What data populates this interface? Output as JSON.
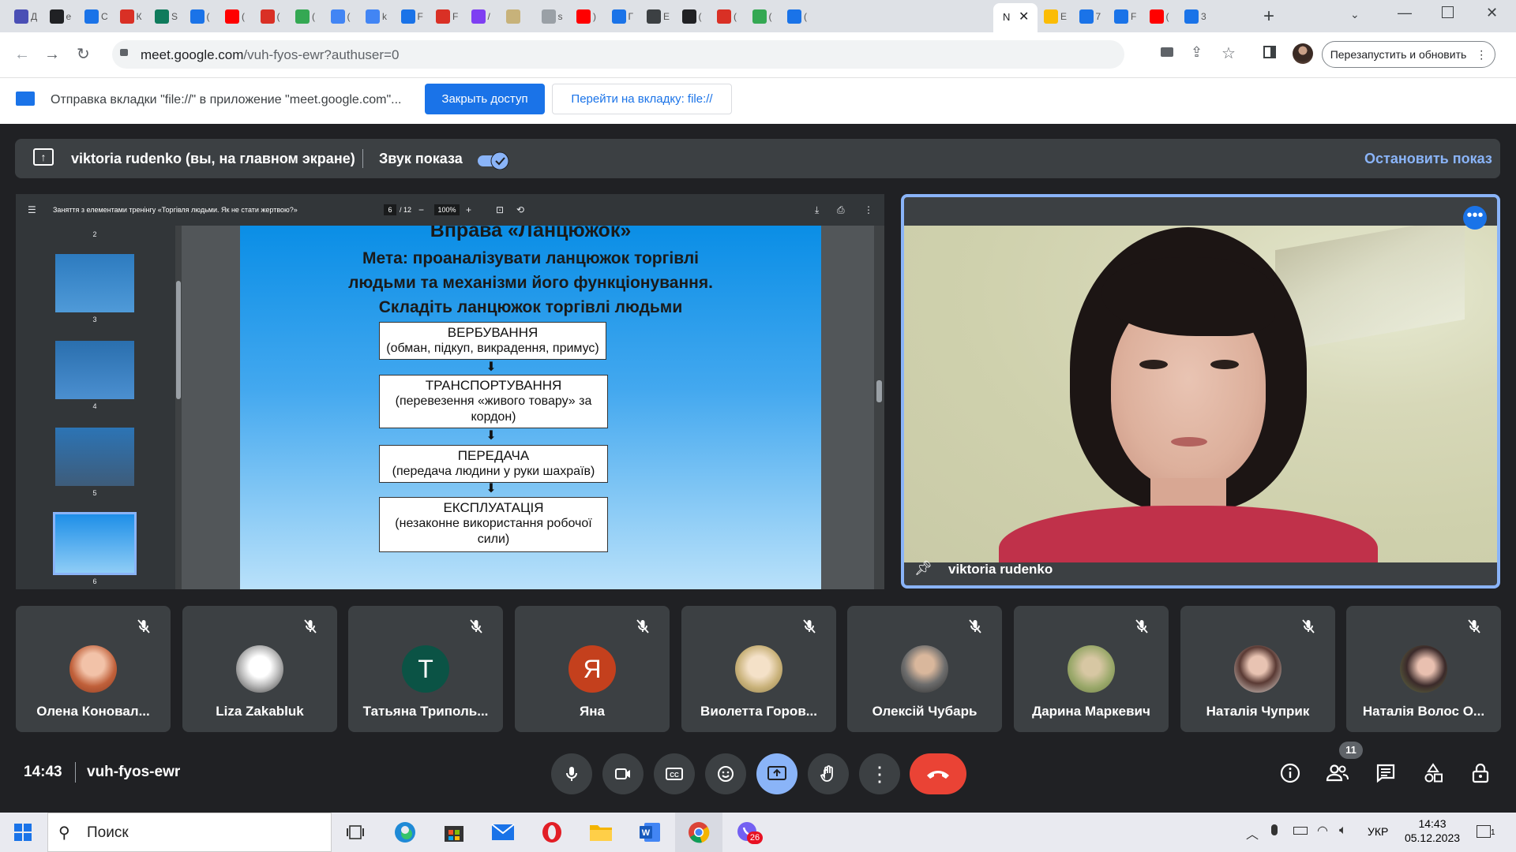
{
  "browser": {
    "tabs": [
      {
        "letter": "Д",
        "color": "#4a4fb5"
      },
      {
        "letter": "е",
        "color": "#202124"
      },
      {
        "letter": "С",
        "color": "#1a73e8"
      },
      {
        "letter": "К",
        "color": "#d93025"
      },
      {
        "letter": "S",
        "color": "#0f7b5c"
      },
      {
        "letter": "(",
        "color": "#1a73e8"
      },
      {
        "letter": "(",
        "color": "#ff0000"
      },
      {
        "letter": "(",
        "color": "#d93025"
      },
      {
        "letter": "(",
        "color": "#34a853"
      },
      {
        "letter": "(",
        "color": "#4285f4"
      },
      {
        "letter": "k",
        "color": "#4285f4"
      },
      {
        "letter": "F",
        "color": "#1a73e8"
      },
      {
        "letter": "F",
        "color": "#d93025"
      },
      {
        "letter": "/",
        "color": "#7e3ff2"
      },
      {
        "letter": "",
        "color": "#c7b27a"
      },
      {
        "letter": "s",
        "color": "#9aa0a6"
      },
      {
        "letter": ")",
        "color": "#ff0000"
      },
      {
        "letter": "Г",
        "color": "#1a73e8"
      },
      {
        "letter": "E",
        "color": "#3c4043"
      },
      {
        "letter": "(",
        "color": "#202124"
      },
      {
        "letter": "(",
        "color": "#d93025"
      },
      {
        "letter": "(",
        "color": "#34a853"
      },
      {
        "letter": "(",
        "color": "#1a73e8"
      }
    ],
    "active_tab_letter": "N",
    "tabs_after": [
      {
        "letter": "E",
        "color": "#fbbc04"
      },
      {
        "letter": "7",
        "color": "#1a73e8"
      },
      {
        "letter": "F",
        "color": "#1a73e8"
      },
      {
        "letter": "(",
        "color": "#ff0000"
      },
      {
        "letter": "3",
        "color": "#1a73e8"
      }
    ],
    "url_host": "meet.google.com",
    "url_path": "/vuh-fyos-ewr?authuser=0",
    "restart_label": "Перезапустить и обновить"
  },
  "infobar": {
    "text": "Отправка вкладки \"file://\" в приложение \"meet.google.com\"...",
    "close_access": "Закрыть доступ",
    "goto_tab": "Перейти на вкладку: file://"
  },
  "present_bar": {
    "presenter": "viktoria rudenko (вы, на главном экране)",
    "audio_label": "Звук показа",
    "audio_on": true,
    "stop_label": "Остановить показ"
  },
  "pdf": {
    "title": "Заняття з елементами тренінгу «Торгівля людьми. Як не стати жертвою?»",
    "page_current": "6",
    "page_total": "/ 12",
    "zoom": "100%",
    "thumbnail_numbers": [
      "2",
      "3",
      "4",
      "5",
      "6"
    ],
    "slide": {
      "title": "Вправа «Ланцюжок»",
      "goal_lines": [
        "Мета: проаналізувати ланцюжок торгівлі",
        "людьми та механізми його функціонування.",
        "Складіть ланцюжок торгівлі людьми"
      ],
      "steps": [
        {
          "heading": "ВЕРБУВАННЯ",
          "desc": "(обман, підкуп, викрадення, примус)"
        },
        {
          "heading": "ТРАНСПОРТУВАННЯ",
          "desc": "(перевезення «живого товару» за кордон)"
        },
        {
          "heading": "ПЕРЕДАЧА",
          "desc": "(передача людини у руки шахраїв)"
        },
        {
          "heading": "ЕКСПЛУАТАЦІЯ",
          "desc": "(незаконне використання робочої сили)"
        }
      ]
    }
  },
  "self_tile": {
    "name": "viktoria rudenko"
  },
  "participants": [
    {
      "name": "Олена Коновал...",
      "avatar": "photo",
      "color": "#c0603a"
    },
    {
      "name": "Liza Zakabluk",
      "avatar": "photo",
      "color": "#e8e8e8"
    },
    {
      "name": "Татьяна Триполь...",
      "avatar": "T",
      "color": "#0b5345"
    },
    {
      "name": "Яна",
      "avatar": "Я",
      "color": "#c4401d"
    },
    {
      "name": "Виолетта Горов...",
      "avatar": "photo",
      "color": "#c9b27a"
    },
    {
      "name": "Олексій Чубарь",
      "avatar": "photo",
      "color": "#6d6d6d"
    },
    {
      "name": "Дарина Маркевич",
      "avatar": "photo",
      "color": "#9aa86a"
    },
    {
      "name": "Наталія Чуприк",
      "avatar": "photo",
      "color": "#b48a78"
    },
    {
      "name": "Наталія Волос О...",
      "avatar": "photo",
      "color": "#3b2a2a"
    }
  ],
  "bottom": {
    "time": "14:43",
    "meeting_code": "vuh-fyos-ewr",
    "people_count": "11"
  },
  "taskbar": {
    "search_placeholder": "Поиск",
    "lang": "УКР",
    "time": "14:43",
    "date": "05.12.2023",
    "viber_badge": "26",
    "notification_count": "1"
  },
  "colors": {
    "meet_bg": "#202124",
    "tile_bg": "#3c4043",
    "accent": "#8ab4f8",
    "end_call": "#ea4335",
    "primary_button": "#1a73e8"
  }
}
